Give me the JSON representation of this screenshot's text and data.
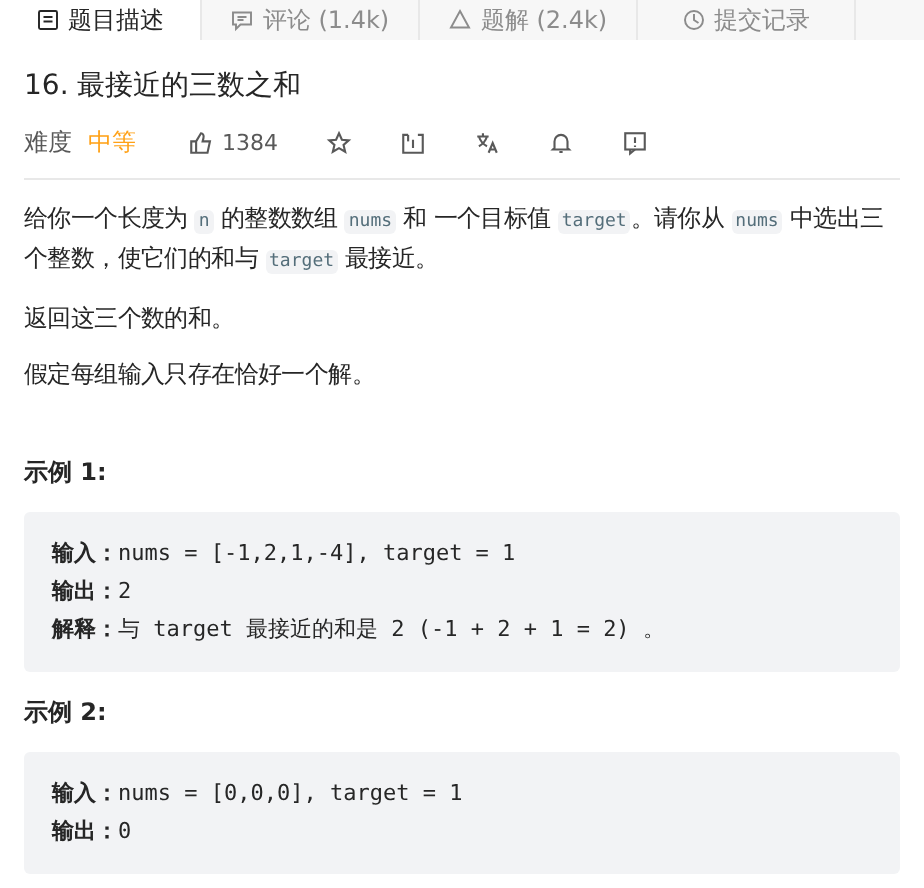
{
  "tabs": [
    {
      "label": "题目描述",
      "kind": "doc",
      "selected": true
    },
    {
      "label": "评论 (1.4k)",
      "kind": "comment",
      "selected": false
    },
    {
      "label": "题解 (2.4k)",
      "kind": "triangle",
      "selected": false
    },
    {
      "label": "提交记录",
      "kind": "clock",
      "selected": false
    }
  ],
  "problem": {
    "title": "16. 最接近的三数之和",
    "difficulty_label": "难度",
    "difficulty": "中等",
    "likes": "1384"
  },
  "paragraphs": [
    [
      {
        "kind": "text",
        "text": "给你一个长度为 "
      },
      {
        "kind": "code",
        "text": "n"
      },
      {
        "kind": "text",
        "text": " 的整数数组 "
      },
      {
        "kind": "code",
        "text": "nums"
      },
      {
        "kind": "text",
        "text": " 和 一个目标值 "
      },
      {
        "kind": "code",
        "text": "target"
      },
      {
        "kind": "text",
        "text": "。请你从 "
      },
      {
        "kind": "code",
        "text": "nums"
      },
      {
        "kind": "text",
        "text": " 中选出三个整数，使它们的和与 "
      },
      {
        "kind": "code",
        "text": "target"
      },
      {
        "kind": "text",
        "text": " 最接近。"
      }
    ],
    [
      {
        "kind": "text",
        "text": "返回这三个数的和。"
      }
    ],
    [
      {
        "kind": "text",
        "text": "假定每组输入只存在恰好一个解。"
      }
    ]
  ],
  "examples": [
    {
      "heading": "示例 1:",
      "lines": [
        "**输入：**nums = [-1,2,1,-4], target = 1",
        "**输出：**2",
        "**解释：**与 target 最接近的和是 2 (-1 + 2 + 1 = 2) 。"
      ]
    },
    {
      "heading": "示例 2:",
      "lines": [
        "**输入：**nums = [0,0,0], target = 1",
        "**输出：**0"
      ]
    }
  ]
}
